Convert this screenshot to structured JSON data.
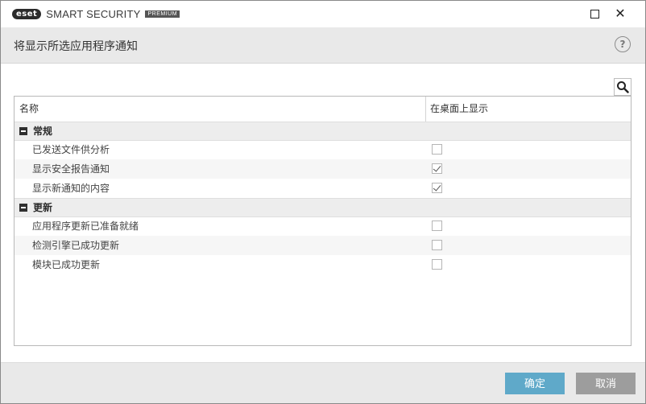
{
  "window": {
    "brand_mark": "eset",
    "product": "SMART SECURITY",
    "edition": "PREMIUM"
  },
  "header": {
    "title": "将显示所选应用程序通知",
    "help_label": "?"
  },
  "table": {
    "columns": [
      "名称",
      "在桌面上显示"
    ],
    "groups": [
      {
        "label": "常规",
        "items": [
          {
            "label": "已发送文件供分析",
            "checked": false
          },
          {
            "label": "显示安全报告通知",
            "checked": true
          },
          {
            "label": "显示新通知的内容",
            "checked": true
          }
        ]
      },
      {
        "label": "更新",
        "items": [
          {
            "label": "应用程序更新已准备就绪",
            "checked": false
          },
          {
            "label": "检测引擎已成功更新",
            "checked": false
          },
          {
            "label": "模块已成功更新",
            "checked": false
          }
        ]
      }
    ]
  },
  "footer": {
    "ok_label": "确定",
    "cancel_label": "取消"
  },
  "colors": {
    "ok_button": "#5fa9c9",
    "cancel_button": "#9d9d9d",
    "header_band": "#e9e9e9"
  }
}
